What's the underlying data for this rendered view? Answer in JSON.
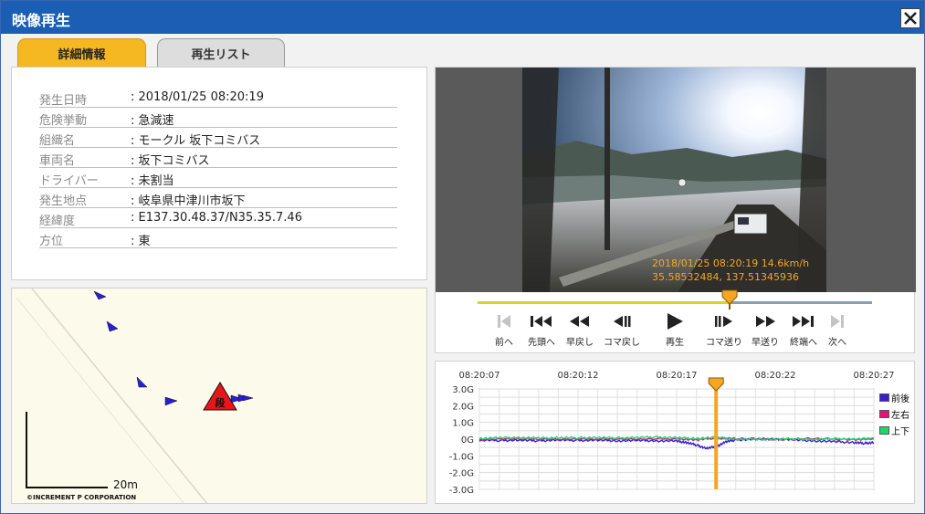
{
  "window": {
    "title": "映像再生"
  },
  "tabs": {
    "detail": "詳細情報",
    "playlist": "再生リスト"
  },
  "info": [
    {
      "label": "発生日時",
      "value": "2018/01/25 08:20:19"
    },
    {
      "label": "危険挙動",
      "value": "急減速"
    },
    {
      "label": "組織名",
      "value": "モークル 坂下コミバス"
    },
    {
      "label": "車両名",
      "value": "坂下コミバス"
    },
    {
      "label": "ドライバー",
      "value": "未割当"
    },
    {
      "label": "発生地点",
      "value": "岐阜県中津川市坂下"
    },
    {
      "label": "経緯度",
      "value": "E137.30.48.37/N35.35.7.46"
    },
    {
      "label": "方位",
      "value": "東"
    }
  ],
  "map": {
    "scale": "20m",
    "copyright": "©INCREMENT P CORPORATION",
    "event_mark": "段",
    "background": "#fbfaeb",
    "marker_color": "#2a1fd6",
    "event_color": "#e8151b"
  },
  "video": {
    "overlay_line1": "2018/01/25 08:20:19 14.6km/h",
    "overlay_line2": "35.58532484, 137.51345936",
    "progress": 0.64
  },
  "controls": [
    {
      "id": "prev",
      "label": "前へ",
      "icon": "skip-prev-icon",
      "enabled": false
    },
    {
      "id": "first",
      "label": "先頭へ",
      "icon": "to-start-icon",
      "enabled": true
    },
    {
      "id": "rewind",
      "label": "早戻し",
      "icon": "rewind-icon",
      "enabled": true
    },
    {
      "id": "frame-back",
      "label": "コマ戻し",
      "icon": "frame-back-icon",
      "enabled": true
    },
    {
      "id": "play",
      "label": "再生",
      "icon": "play-icon",
      "enabled": true
    },
    {
      "id": "frame-fwd",
      "label": "コマ送り",
      "icon": "frame-forward-icon",
      "enabled": true
    },
    {
      "id": "ffwd",
      "label": "早送り",
      "icon": "fast-forward-icon",
      "enabled": true
    },
    {
      "id": "last",
      "label": "終端へ",
      "icon": "to-end-icon",
      "enabled": true
    },
    {
      "id": "next",
      "label": "次へ",
      "icon": "skip-next-icon",
      "enabled": false
    }
  ],
  "chart_data": {
    "type": "line",
    "x_ticks": [
      "08:20:07",
      "08:20:12",
      "08:20:17",
      "08:20:22",
      "08:20:27"
    ],
    "y_ticks": [
      "3.0G",
      "2.0G",
      "1.0G",
      "0G",
      "-1.0G",
      "-2.0G",
      "-3.0G"
    ],
    "ylim": [
      -3,
      3
    ],
    "x_start_sec": 7,
    "x_end_sec": 27,
    "marker_sec": 19,
    "grid": true,
    "legend_position": "right",
    "series": [
      {
        "name": "前後",
        "color": "#3a1fd0",
        "values": [
          [
            7,
            -0.05
          ],
          [
            8,
            -0.08
          ],
          [
            9,
            -0.06
          ],
          [
            10,
            -0.1
          ],
          [
            11,
            -0.05
          ],
          [
            12,
            -0.08
          ],
          [
            13,
            -0.06
          ],
          [
            14,
            -0.1
          ],
          [
            15,
            -0.08
          ],
          [
            16,
            -0.1
          ],
          [
            17,
            -0.12
          ],
          [
            17.5,
            -0.2
          ],
          [
            18,
            -0.35
          ],
          [
            18.5,
            -0.55
          ],
          [
            19,
            -0.45
          ],
          [
            19.5,
            -0.15
          ],
          [
            20,
            -0.05
          ],
          [
            21,
            0
          ],
          [
            22,
            0.02
          ],
          [
            23,
            -0.05
          ],
          [
            24,
            -0.1
          ],
          [
            25,
            -0.15
          ],
          [
            26,
            -0.2
          ],
          [
            26.5,
            -0.25
          ],
          [
            27,
            -0.2
          ]
        ]
      },
      {
        "name": "左右",
        "color": "#e0157a",
        "values": [
          [
            7,
            -0.02
          ],
          [
            9,
            0.02
          ],
          [
            11,
            -0.01
          ],
          [
            13,
            0.02
          ],
          [
            15,
            0
          ],
          [
            17,
            0.03
          ],
          [
            18,
            -0.05
          ],
          [
            19,
            0.08
          ],
          [
            20,
            0.02
          ],
          [
            22,
            0
          ],
          [
            24,
            0.02
          ],
          [
            26,
            -0.02
          ],
          [
            27,
            0
          ]
        ]
      },
      {
        "name": "上下",
        "color": "#19d96b",
        "values": [
          [
            7,
            0.05
          ],
          [
            8,
            0.08
          ],
          [
            9,
            0.1
          ],
          [
            10,
            0.06
          ],
          [
            11,
            0.09
          ],
          [
            12,
            0.08
          ],
          [
            13,
            0.1
          ],
          [
            14,
            0.07
          ],
          [
            15,
            0.1
          ],
          [
            16,
            0.12
          ],
          [
            17,
            0.08
          ],
          [
            18,
            0.05
          ],
          [
            19,
            0.1
          ],
          [
            20,
            0
          ],
          [
            21,
            -0.02
          ],
          [
            22,
            0
          ],
          [
            23,
            0.02
          ],
          [
            24,
            -0.02
          ],
          [
            25,
            0.03
          ],
          [
            26,
            0
          ],
          [
            27,
            0.05
          ]
        ]
      }
    ]
  }
}
